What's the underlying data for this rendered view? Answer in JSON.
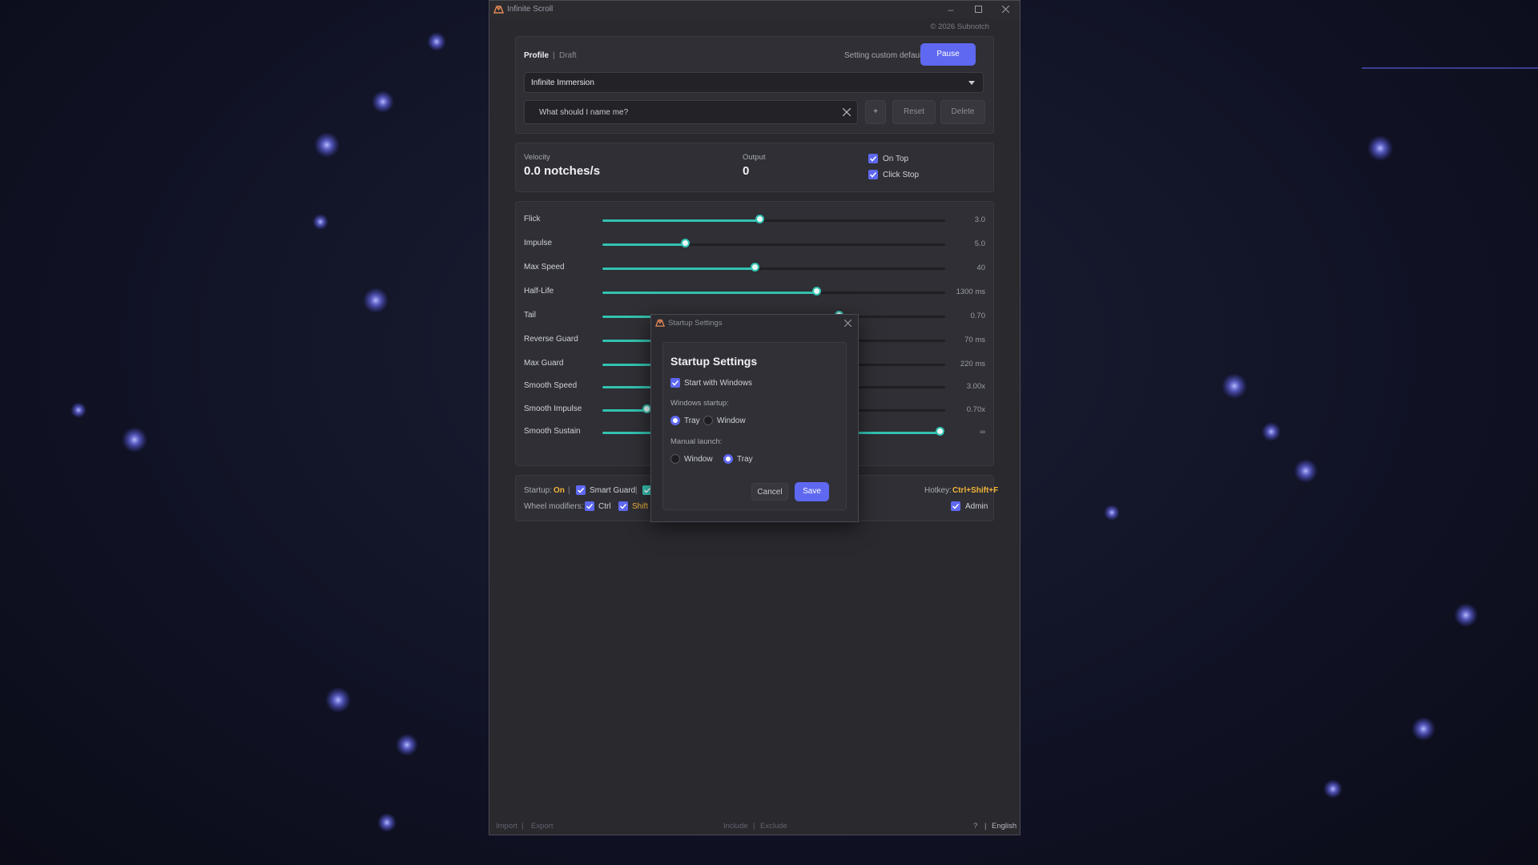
{
  "window": {
    "title": "Infinite Scroll",
    "copyright": "© 2026 Subnotch"
  },
  "profile": {
    "tab_profile": "Profile",
    "tab_draft": "Draft",
    "status_text": "Setting custom defaults",
    "pause_label": "Pause",
    "selected_profile": "Infinite Immersion",
    "name_placeholder": "What should I name me?",
    "add_label": "+",
    "reset_label": "Reset",
    "delete_label": "Delete"
  },
  "stats": {
    "velocity_label": "Velocity",
    "velocity_value": "0.0 notches/s",
    "output_label": "Output",
    "output_value": "0",
    "on_top_label": "On Top",
    "click_stop_label": "Click Stop"
  },
  "sliders": [
    {
      "label": "Flick",
      "value_text": "3.0",
      "fraction": 0.46
    },
    {
      "label": "Impulse",
      "value_text": "5.0",
      "fraction": 0.243
    },
    {
      "label": "Max Speed",
      "value_text": "40",
      "fraction": 0.446
    },
    {
      "label": "Half-Life",
      "value_text": "1300 ms",
      "fraction": 0.626
    },
    {
      "label": "Tail",
      "value_text": "0.70",
      "fraction": 0.692
    },
    {
      "label": "Reverse Guard",
      "value_text": "70 ms",
      "fraction": 0.5
    },
    {
      "label": "Max Guard",
      "value_text": "220 ms",
      "fraction": 0.5
    },
    {
      "label": "Smooth Speed",
      "value_text": "3.00x",
      "fraction": 0.5
    },
    {
      "label": "Smooth Impulse",
      "value_text": "0.70x",
      "fraction": 0.13
    },
    {
      "label": "Smooth Sustain",
      "value_text": "∞",
      "fraction": 0.987
    }
  ],
  "settings": {
    "startup_label": "Startup:",
    "startup_value": "On",
    "smart_guard_label": "Smart Guard",
    "hotkey_label": "Hotkey:",
    "hotkey_value": "Ctrl+Shift+F",
    "wheel_modifiers_label": "Wheel modifiers:",
    "ctrl_label": "Ctrl",
    "shift_label": "Shift",
    "admin_label": "Admin",
    "separator": "|"
  },
  "footer": {
    "import": "Import",
    "export": "Export",
    "include": "Include",
    "exclude": "Exclude",
    "help": "?",
    "language": "English",
    "separator": "|"
  },
  "dialog": {
    "window_title": "Startup Settings",
    "heading": "Startup Settings",
    "start_with_windows": "Start with Windows",
    "windows_startup_label": "Windows startup:",
    "ws_option_tray": "Tray",
    "ws_option_window": "Window",
    "manual_launch_label": "Manual launch:",
    "ml_option_window": "Window",
    "ml_option_tray": "Tray",
    "cancel_label": "Cancel",
    "save_label": "Save"
  },
  "colors": {
    "accent": "#5f68f0",
    "slider": "#33c2b0",
    "highlight": "#f2b43a"
  }
}
